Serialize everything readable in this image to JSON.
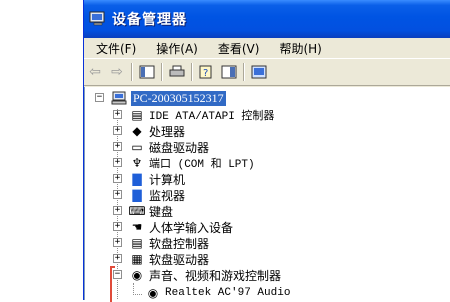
{
  "window": {
    "title": "设备管理器",
    "icon": "device-manager-icon"
  },
  "menu": [
    {
      "label": "文件(F)"
    },
    {
      "label": "操作(A)"
    },
    {
      "label": "查看(V)"
    },
    {
      "label": "帮助(H)"
    }
  ],
  "toolbar": {
    "buttons": [
      "back-icon",
      "forward-icon",
      "properties-pane-icon",
      "print-icon",
      "help-icon",
      "view-icon",
      "scan-hardware-icon"
    ]
  },
  "tree": {
    "root": "PC-200305152317",
    "items": [
      {
        "label": "IDE ATA/ATAPI 控制器",
        "icon": "ide-controller-icon"
      },
      {
        "label": "处理器",
        "icon": "processor-icon"
      },
      {
        "label": "磁盘驱动器",
        "icon": "disk-drive-icon"
      },
      {
        "label": "端口 (COM 和 LPT)",
        "icon": "port-icon"
      },
      {
        "label": "计算机",
        "icon": "computer-icon"
      },
      {
        "label": "监视器",
        "icon": "monitor-icon"
      },
      {
        "label": "键盘",
        "icon": "keyboard-icon"
      },
      {
        "label": "人体学输入设备",
        "icon": "hid-icon"
      },
      {
        "label": "软盘控制器",
        "icon": "floppy-controller-icon"
      },
      {
        "label": "软盘驱动器",
        "icon": "floppy-drive-icon"
      },
      {
        "label": "声音、视频和游戏控制器",
        "icon": "sound-icon",
        "expanded": true
      }
    ],
    "child": {
      "label": "Realtek AC'97 Audio",
      "icon": "audio-device-icon"
    }
  },
  "colors": {
    "titlebar": "#0054e3",
    "selection": "#316ac5",
    "highlight": "#e04b3a"
  }
}
